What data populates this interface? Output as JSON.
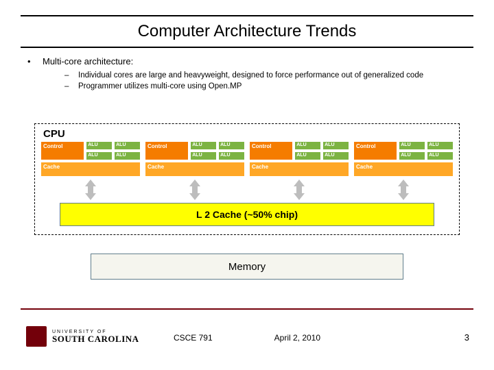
{
  "title": "Computer Architecture Trends",
  "main_bullet": "Multi-core architecture:",
  "sub_bullets": [
    "Individual cores are large and heavyweight, designed to force performance out of generalized code",
    "Programmer utilizes multi-core using Open.MP"
  ],
  "diagram": {
    "cpu_label": "CPU",
    "control_label": "Control",
    "alu_label": "ALU",
    "cache_label": "Cache",
    "l2_label": "L 2 Cache (~50% chip)",
    "memory_label": "Memory"
  },
  "university": {
    "top": "UNIVERSITY OF",
    "name": "SOUTH CAROLINA"
  },
  "footer": {
    "course": "CSCE 791",
    "date": "April 2, 2010",
    "page": "3"
  }
}
